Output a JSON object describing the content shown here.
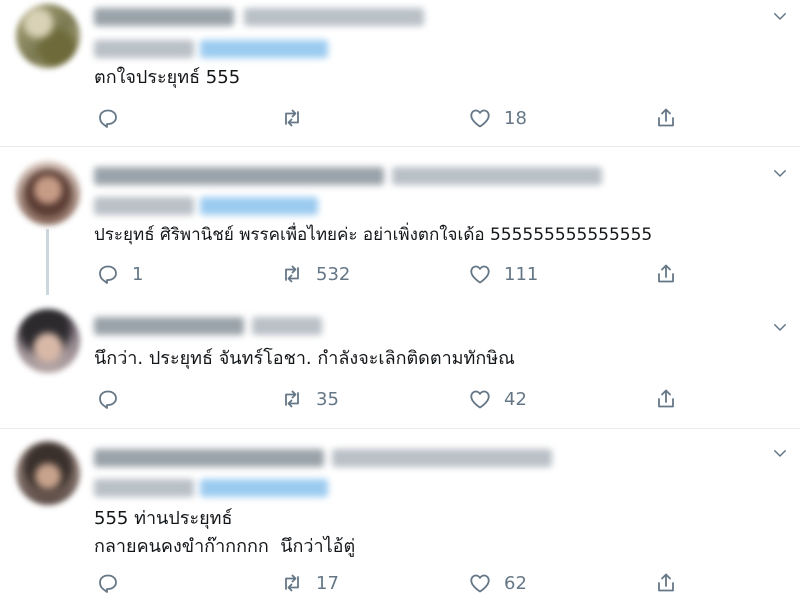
{
  "tweets": [
    {
      "text_lines": [
        "ตกใจประยุทธ์ 555"
      ],
      "reply_count": "",
      "retweet_count": "",
      "like_count": "18"
    },
    {
      "text_lines": [
        "ประยุทธ์ ศิริพานิชย์ พรรคเพื่อไทยค่ะ อย่าเพิ่งตกใจเด้อ 555555555555555"
      ],
      "reply_count": "1",
      "retweet_count": "532",
      "like_count": "111"
    },
    {
      "text_lines": [
        "นึกว่า. ประยุทธ์ จันทร์โอชา. กำลังจะเลิกติดตามทักษิณ"
      ],
      "reply_count": "",
      "retweet_count": "35",
      "like_count": "42"
    },
    {
      "text_lines": [
        "555 ท่านประยุทธ์",
        "กลายคนคงขำก๊ากกกก  นึกว่าไอ้ตู่"
      ],
      "reply_count": "",
      "retweet_count": "17",
      "like_count": "62"
    }
  ],
  "icons": {
    "reply": "reply-icon",
    "retweet": "retweet-icon",
    "like": "heart-icon",
    "share": "share-icon",
    "more": "chevron-down-icon"
  },
  "colors": {
    "text": "#14171a",
    "secondary": "#657786",
    "divider": "#e6ecf0",
    "thread": "#ccd6dd"
  }
}
